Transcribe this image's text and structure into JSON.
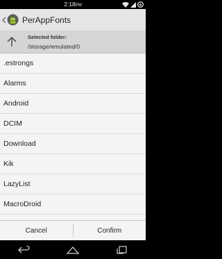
{
  "status_bar": {
    "time": "2:18",
    "ampm": "PM",
    "icons": [
      "wifi-icon",
      "signal-icon",
      "battery-icon"
    ]
  },
  "action_bar": {
    "title": "PerAppFonts",
    "icons": [
      "chevron-left-icon",
      "android-app-icon"
    ]
  },
  "folder_bar": {
    "label": "Selected folder:",
    "path": "/storage/emulated/0",
    "icon": "arrow-up-icon"
  },
  "folders": [
    ".estrongs",
    "Alarms",
    "Android",
    "DCIM",
    "Download",
    "Kik",
    "LazyList",
    "MacroDroid"
  ],
  "buttons": {
    "cancel": "Cancel",
    "confirm": "Confirm"
  },
  "nav_bar": {
    "icons": [
      "back-icon",
      "home-icon",
      "recents-icon"
    ]
  },
  "colors": {
    "action_bar": "#e6e6e6",
    "folder_bar": "#d5d5d5",
    "list_background": "#f4f4f4",
    "android_green": "#97c024"
  }
}
